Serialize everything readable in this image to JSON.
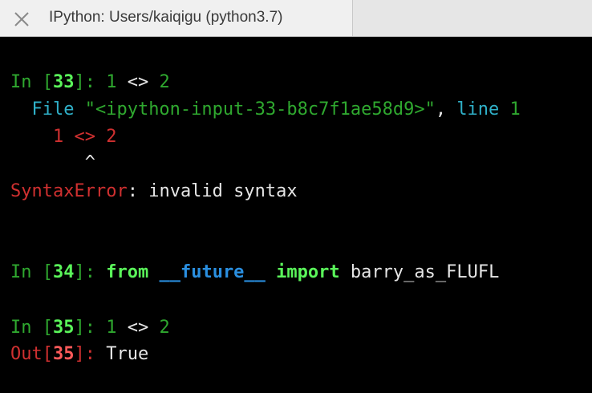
{
  "tab": {
    "title": "IPython: Users/kaiqigu (python3.7)"
  },
  "colors": {
    "background": "#000000",
    "prompt_green": "#2fa82f",
    "prompt_number_green": "#5af55a",
    "error_red": "#d03030",
    "out_number_red": "#ff5a5a",
    "traceback_cyan": "#2fb0c8",
    "module_blue": "#2a8fe0",
    "text": "#e6e6e6"
  },
  "icons": {
    "close": "close-icon"
  },
  "cell33": {
    "prompt_in": "In [",
    "number": "33",
    "prompt_close": "]: ",
    "code_1": "1",
    "code_op": " <> ",
    "code_2": "2"
  },
  "traceback": {
    "file_prefix": "  File ",
    "file_name": "\"<ipython-input-33-b8c7f1ae58d9>\"",
    "comma": ", ",
    "line_word": "line ",
    "line_number": "1",
    "src_indent": "    ",
    "src_1": "1",
    "src_op": " <> ",
    "src_2": "2",
    "caret": "       ^",
    "error_type": "SyntaxError",
    "error_colon": ": ",
    "error_message": "invalid syntax"
  },
  "cell34": {
    "prompt_in": "In [",
    "number": "34",
    "prompt_close": "]: ",
    "kw_from": "from",
    "module": "__future__",
    "kw_import": "import",
    "name": "barry_as_FLUFL"
  },
  "cell35": {
    "prompt_in": "In [",
    "number": "35",
    "prompt_close": "]: ",
    "code_1": "1",
    "code_op": " <> ",
    "code_2": "2",
    "out_prompt": "Out[",
    "out_number": "35",
    "out_close": "]: ",
    "out_value": "True"
  }
}
